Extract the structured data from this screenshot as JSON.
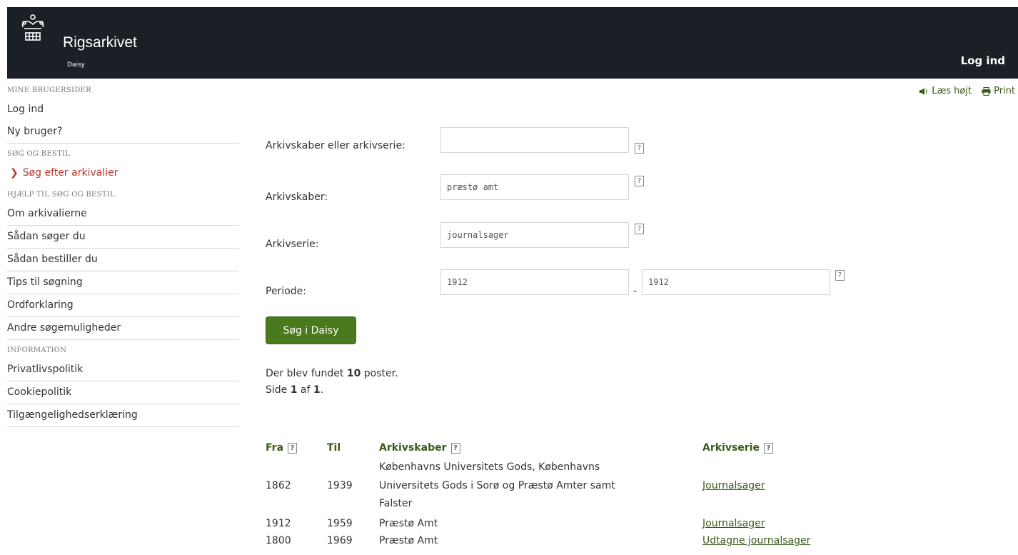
{
  "header": {
    "brand": "Rigsarkivet",
    "sub": "Daisy",
    "login": "Log ind"
  },
  "tools": {
    "read_aloud": "Læs højt",
    "print": "Print"
  },
  "sidebar": {
    "sections": [
      {
        "heading": "MINE BRUGERSIDER",
        "items": [
          "Log ind",
          "Ny bruger?"
        ]
      },
      {
        "heading": "SØG OG BESTIL",
        "items": [
          "Søg efter arkivalier"
        ]
      },
      {
        "heading": "HJÆLP TIL SØG OG BESTIL",
        "items": [
          "Om arkivalierne",
          "Sådan søger du",
          "Sådan bestiller du",
          "Tips til søgning",
          "Ordforklaring",
          "Andre søgemuligheder"
        ]
      },
      {
        "heading": "INFORMATION",
        "items": [
          "Privatlivspolitik",
          "Cookiepolitik",
          "Tilgængelighedserklæring"
        ]
      }
    ]
  },
  "form": {
    "label_creator_or_series": "Arkivskaber eller arkivserie:",
    "label_creator": "Arkivskaber:",
    "label_series": "Arkivserie:",
    "label_period": "Periode:",
    "value_creator_or_series": "",
    "value_creator": "præstø amt",
    "value_series": "journalsager",
    "value_from": "1912",
    "value_to": "1912",
    "help": "?",
    "dash": "-",
    "search_button": "Søg i Daisy"
  },
  "results": {
    "found_pre": "Der blev fundet ",
    "found_count": "10",
    "found_post": " poster.",
    "page_pre": "Side ",
    "page_current": "1",
    "page_mid": " af ",
    "page_total": "1",
    "page_post": "."
  },
  "table": {
    "headers": {
      "from": "Fra",
      "to": "Til",
      "creator": "Arkivskaber",
      "series": "Arkivserie"
    },
    "rows": [
      {
        "from": "1862",
        "to": "1939",
        "creator_lines": [
          "Københavns Universitets Gods, Københavns",
          "Universitets Gods i Sorø og Præstø Amter samt",
          "Falster"
        ],
        "series": "Journalsager"
      },
      {
        "from": "1912",
        "to": "1959",
        "creator_lines": [
          "Præstø Amt"
        ],
        "series": "Journalsager"
      },
      {
        "from": "1800",
        "to": "1969",
        "creator_lines": [
          "Præstø Amt"
        ],
        "series": "Udtagne journalsager"
      }
    ]
  },
  "colors": {
    "topbar": "#1b2027",
    "accent_green": "#4b7a1e",
    "link_green": "#3c5a1a",
    "active_red": "#b73a2d"
  }
}
